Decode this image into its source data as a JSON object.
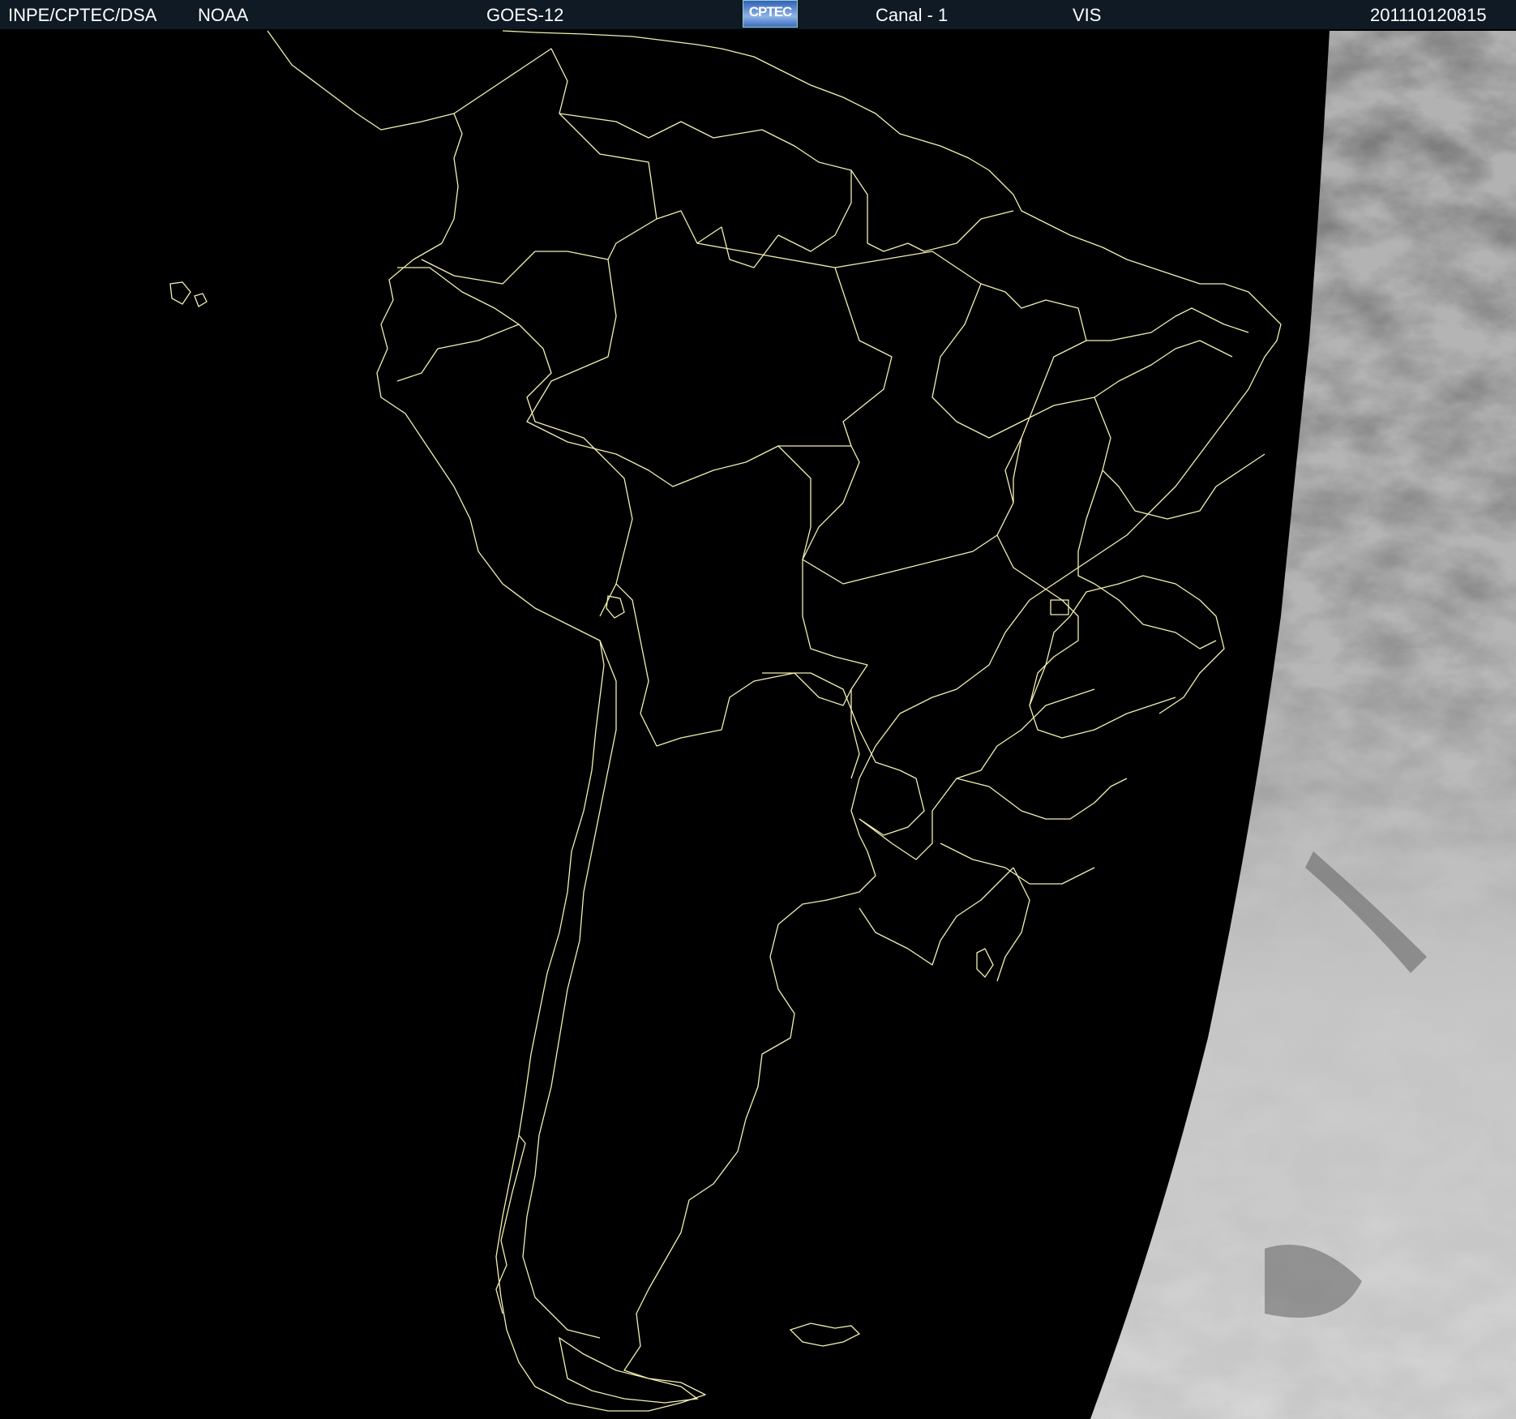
{
  "header": {
    "agency": "INPE/CPTEC/DSA",
    "source": "NOAA",
    "satellite": "GOES-12",
    "logo_text": "CPTEC",
    "channel": "Canal - 1",
    "band": "VIS",
    "timestamp": "201110120815"
  },
  "map": {
    "region": "South America",
    "background_color": "#000000",
    "border_color": "#f2f0b0",
    "cloud_color": "#b8b8b8",
    "header_color": "#0f1a24"
  }
}
